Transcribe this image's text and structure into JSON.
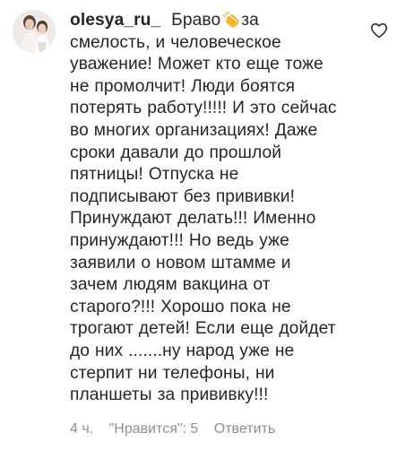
{
  "comment": {
    "username": "olesya_ru_",
    "lines": [
      "Браво",
      "смелость, и человеческое",
      "уважение! Может кто еще тоже",
      "не промолчит! Люди боятся",
      "потерять работу!!!!! И это сейчас",
      "во многих организациях! Даже",
      "сроки давали до прошлой",
      "пятницы! Отпуска не",
      "подписывают без прививки!",
      "Принуждают делать!!! Именно",
      "принуждают!!! Но ведь уже",
      "заявили о новом штамме и",
      "зачем людям вакцина от",
      "старого?!!! Хорошо пока не",
      "трогают детей! Если еще дойдет",
      "до них .......ну народ уже не",
      "стерпит ни телефоны, ни",
      "планшеты за прививку!!!"
    ],
    "first_line_tail": "за",
    "emoji": "clapping-hands",
    "time": "4 ч.",
    "likes": "\"Нравится\": 5",
    "reply": "Ответить"
  },
  "colors": {
    "text": "#262626",
    "meta": "#8e8e8e",
    "clap": "#f5b731"
  }
}
